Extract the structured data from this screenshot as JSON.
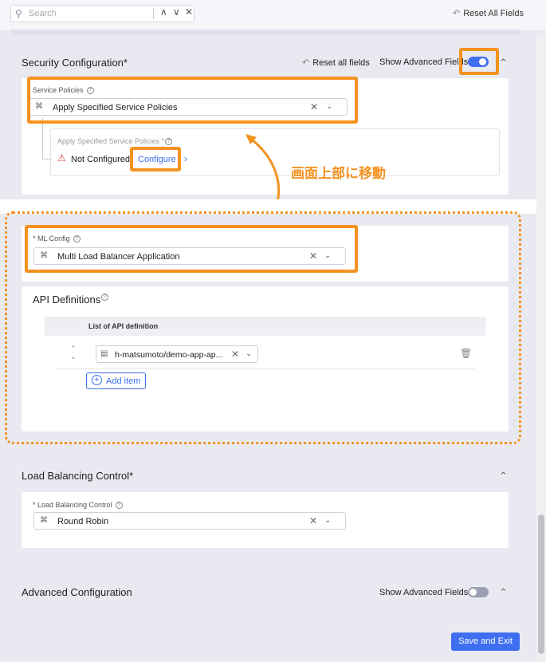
{
  "topbar": {
    "search_placeholder": "Search",
    "nav_up": "∧",
    "nav_down": "∨",
    "clear": "✕",
    "reset_all_fields": "Reset All Fields"
  },
  "security": {
    "title": "Security Configuration",
    "required_mark": "*",
    "reset_all_fields": "Reset all fields",
    "show_advanced_fields": "Show Advanced Fields",
    "advanced_on": true,
    "service_policies": {
      "label": "* Service Policies",
      "value": "Apply Specified Service Policies"
    },
    "apply_specified": {
      "label": "Apply Specified Service Policies *",
      "status": "Not Configured",
      "configure": "Configure"
    }
  },
  "annotation": {
    "text": "画面上部に移動",
    "color": "#f59220"
  },
  "ml_config": {
    "label": "* ML Config",
    "value": "Multi Load Balancer Application"
  },
  "api_definitions": {
    "title": "API Definitions",
    "column_header": "List of API definition",
    "items": [
      {
        "value": "h-matsumoto/demo-app-ap..."
      }
    ],
    "add_item": "Add item"
  },
  "load_balancing": {
    "title": "Load Balancing Control",
    "required_mark": "*",
    "field_label": "* Load Balancing Control",
    "value": "Round Robin"
  },
  "advanced": {
    "title": "Advanced Configuration",
    "show_advanced_fields": "Show Advanced Fields",
    "advanced_on": false
  },
  "footer": {
    "save_and_exit": "Save and Exit"
  },
  "colors": {
    "accent": "#3f6ff0",
    "highlight": "#f59220",
    "warning": "#e03c3c"
  }
}
